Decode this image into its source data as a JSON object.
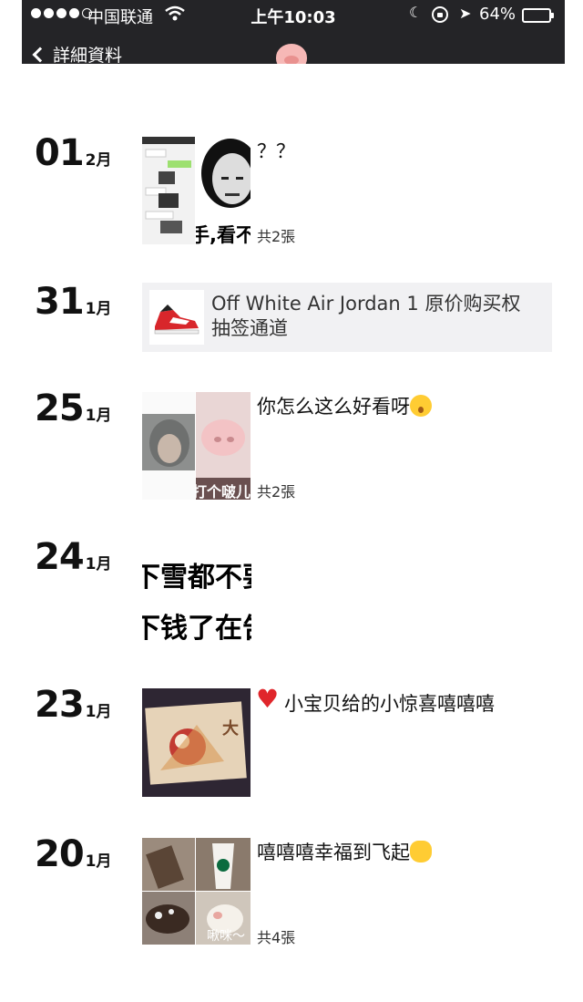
{
  "status_bar": {
    "carrier": "中国联通",
    "time": "上午10:03",
    "battery": "64%",
    "battery_level": 0.64
  },
  "nav": {
    "back_label": "詳細資料"
  },
  "entries": [
    {
      "day": "01",
      "month": "2月",
      "caption": "？？",
      "meme_text": "手,看不",
      "count": "共2張"
    },
    {
      "day": "31",
      "month": "1月",
      "share_title": "Off White Air Jordan 1 原价购买权抽签通道"
    },
    {
      "day": "25",
      "month": "1月",
      "caption": "你怎么这么好看呀",
      "overlay_text": "打个啵儿吗",
      "count": "共2張"
    },
    {
      "day": "24",
      "month": "1月",
      "text_lines": [
        "下雪都不要",
        "下钱了在告"
      ]
    },
    {
      "day": "23",
      "month": "1月",
      "caption": "小宝贝给的小惊喜嘻嘻嘻"
    },
    {
      "day": "20",
      "month": "1月",
      "caption": "嘻嘻嘻幸福到飞起",
      "overlay_text": "啾咪～",
      "count": "共4張"
    }
  ],
  "colors": {
    "topbar": "#242427",
    "share_bg": "#f1f1f3",
    "heart": "#e0262b",
    "emoji": "#ffcc33"
  }
}
